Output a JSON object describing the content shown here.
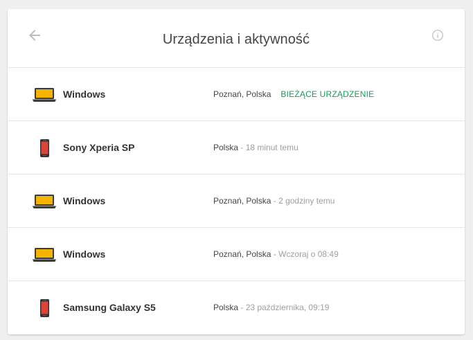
{
  "header": {
    "title": "Urządzenia i aktywność",
    "back_icon": "arrow-left-icon",
    "info_icon": "info-icon"
  },
  "colors": {
    "current_device": "#0f9d58",
    "laptop_body": "#f4b400",
    "phone_screen": "#db4437"
  },
  "devices": [
    {
      "icon": "laptop-icon",
      "name": "Windows",
      "location": "Poznań, Polska",
      "separator": "",
      "time": "",
      "current_label": "BIEŻĄCE URZĄDZENIE"
    },
    {
      "icon": "phone-icon",
      "name": "Sony Xperia SP",
      "location": "Polska",
      "separator": " - ",
      "time": "18 minut temu",
      "current_label": ""
    },
    {
      "icon": "laptop-icon",
      "name": "Windows",
      "location": "Poznań, Polska",
      "separator": " - ",
      "time": "2 godziny temu",
      "current_label": ""
    },
    {
      "icon": "laptop-icon",
      "name": "Windows",
      "location": "Poznań, Polska",
      "separator": " - ",
      "time": "Wczoraj o 08:49",
      "current_label": ""
    },
    {
      "icon": "phone-icon",
      "name": "Samsung Galaxy S5",
      "location": "Polska",
      "separator": " - ",
      "time": "23 października, 09:19",
      "current_label": ""
    }
  ]
}
